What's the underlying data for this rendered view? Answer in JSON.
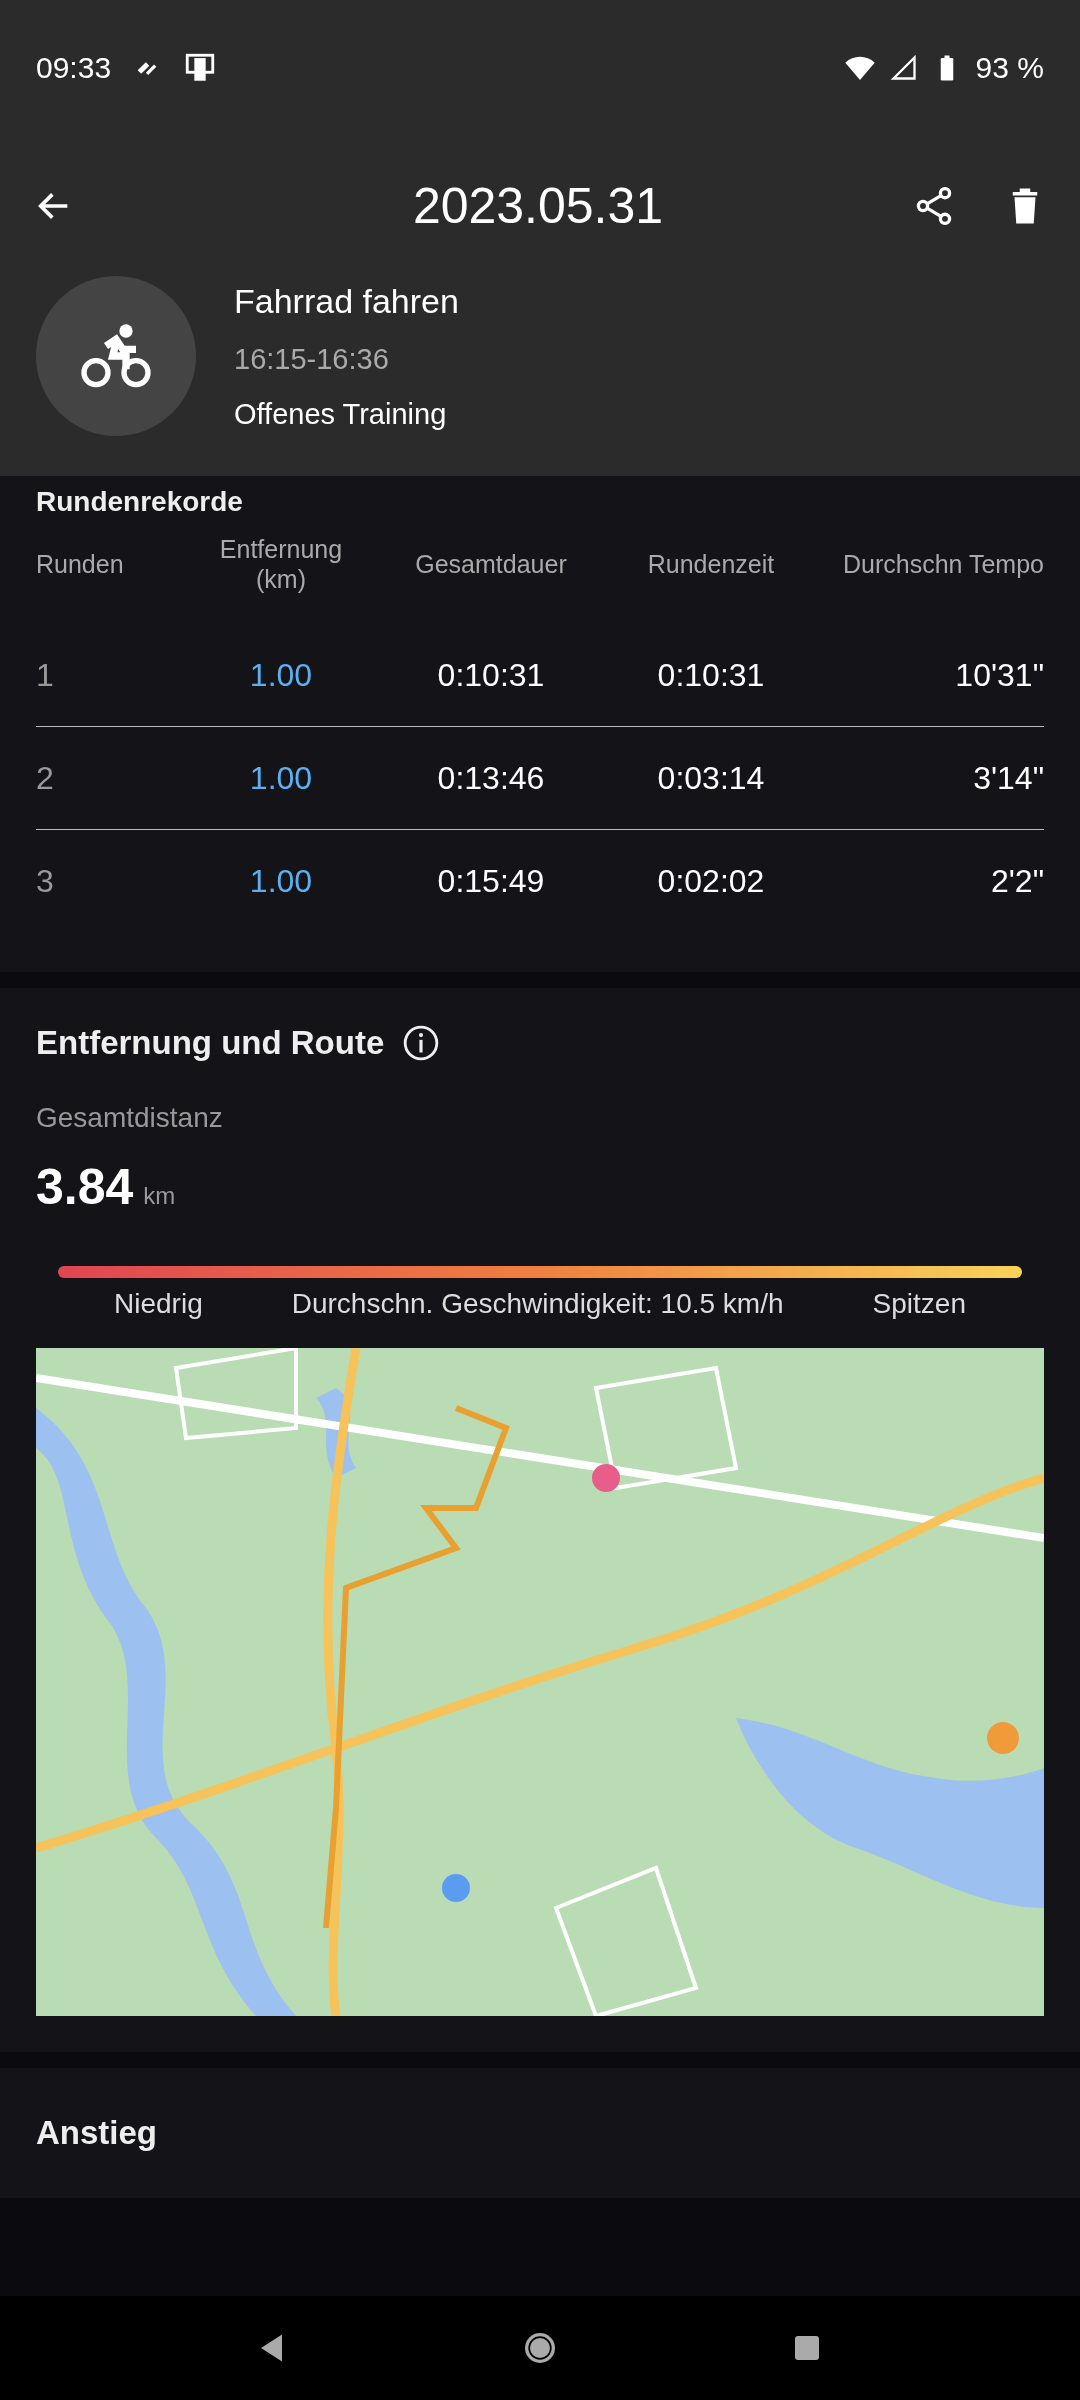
{
  "status_bar": {
    "time": "09:33",
    "battery": "93 %"
  },
  "toolbar": {
    "title": "2023.05.31"
  },
  "activity": {
    "name": "Fahrrad fahren",
    "time_range": "16:15-16:36",
    "mode": "Offenes Training"
  },
  "laps": {
    "title": "Rundenrekorde",
    "columns": [
      "Runden",
      "Entfernung\n(km)",
      "Gesamtdauer",
      "Rundenzeit",
      "Durchschn Tempo"
    ],
    "rows": [
      [
        "1",
        "1.00",
        "0:10:31",
        "0:10:31",
        "10'31\""
      ],
      [
        "2",
        "1.00",
        "0:13:46",
        "0:03:14",
        "3'14\""
      ],
      [
        "3",
        "1.00",
        "0:15:49",
        "0:02:02",
        "2'2\""
      ]
    ]
  },
  "route": {
    "title": "Entfernung und Route",
    "total_label": "Gesamtdistanz",
    "total_value": "3.84",
    "total_unit": "km",
    "legend_low": "Niedrig",
    "legend_avg": "Durchschn. Geschwindigkeit: 10.5 km/h",
    "legend_high": "Spitzen"
  },
  "ascent": {
    "title": "Anstieg"
  }
}
